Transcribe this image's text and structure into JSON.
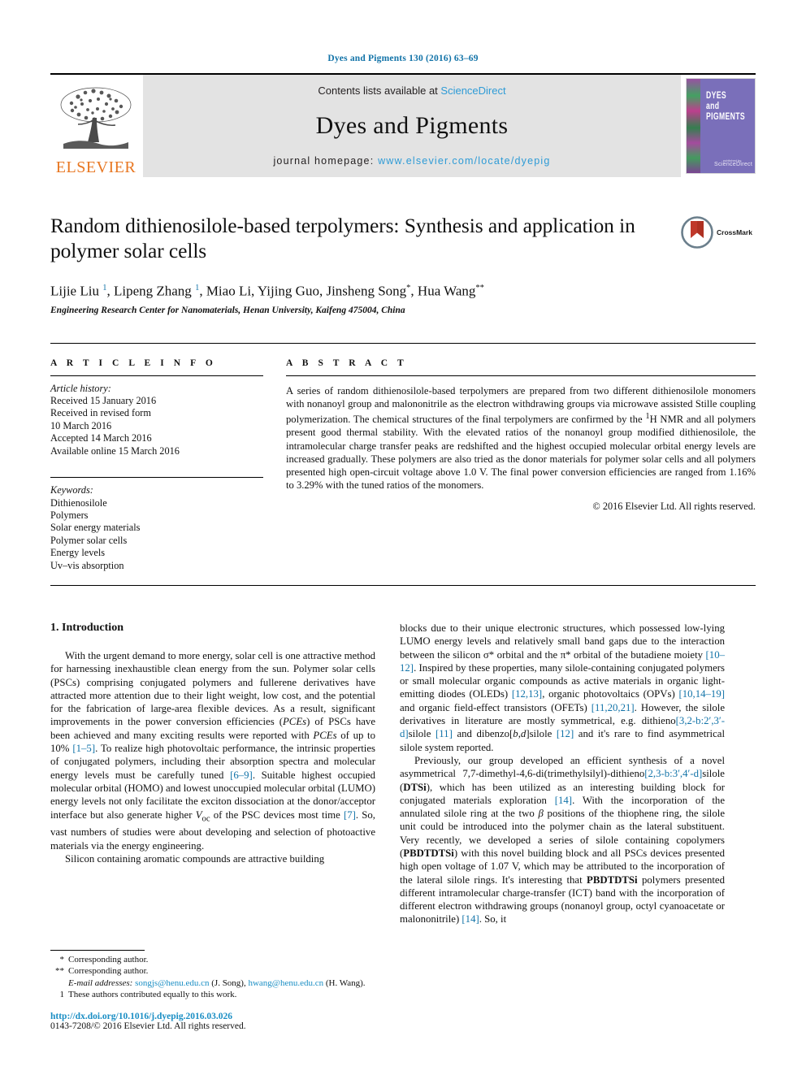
{
  "running_head": "Dyes and Pigments 130 (2016) 63–69",
  "masthead": {
    "publisher_wordmark": "ELSEVIER",
    "contents_prefix": "Contents lists available at ",
    "contents_link": "ScienceDirect",
    "journal_title": "Dyes and Pigments",
    "homepage_prefix": "journal homepage: ",
    "homepage_link": "www.elsevier.com/locate/dyepig",
    "cover_title_line1": "DYES",
    "cover_title_line2": "and",
    "cover_title_line3": "PIGMENTS",
    "cover_pub_note": "published by",
    "cover_pub_name": "ScienceDirect",
    "accent_link_color": "#2e9bd6",
    "elsevier_orange": "#e87722",
    "cover_purple": "#7a6fba"
  },
  "article": {
    "title": "Random dithienosilole-based terpolymers: Synthesis and application in polymer solar cells",
    "crossmark_label": "CrossMark",
    "authors_html": "Lijie Liu <sup>1</sup>, Lipeng Zhang <sup>1</sup>, Miao Li, Yijing Guo, Jinsheng Song<sup class=\"star\">*</sup>, Hua Wang<sup class=\"star\">**</sup>",
    "affiliation": "Engineering Research Center for Nanomaterials, Henan University, Kaifeng 475004, China"
  },
  "article_info": {
    "heading": "A R T I C L E   I N F O",
    "history_label": "Article history:",
    "history_lines": [
      "Received 15 January 2016",
      "Received in revised form",
      "10 March 2016",
      "Accepted 14 March 2016",
      "Available online 15 March 2016"
    ],
    "keywords_label": "Keywords:",
    "keywords": [
      "Dithienosilole",
      "Polymers",
      "Solar energy materials",
      "Polymer solar cells",
      "Energy levels",
      "Uv–vis absorption"
    ]
  },
  "abstract": {
    "heading": "A B S T R A C T",
    "text": "A series of random dithienosilole-based terpolymers are prepared from two different dithienosilole monomers with nonanoyl group and malononitrile as the electron withdrawing groups via microwave assisted Stille coupling polymerization. The chemical structures of the final terpolymers are confirmed by the 1H NMR and all polymers present good thermal stability. With the elevated ratios of the nonanoyl group modified dithienosilole, the intramolecular charge transfer peaks are redshifted and the highest occupied molecular orbital energy levels are increased gradually. These polymers are also tried as the donor materials for polymer solar cells and all polymers presented high open-circuit voltage above 1.0 V. The final power conversion efficiencies are ranged from 1.16% to 3.29% with the tuned ratios of the monomers.",
    "copyright": "© 2016 Elsevier Ltd. All rights reserved."
  },
  "body": {
    "section_title": "1. Introduction",
    "left_paragraphs": [
      "With the urgent demand to more energy, solar cell is one attractive method for harnessing inexhaustible clean energy from the sun. Polymer solar cells (PSCs) comprising conjugated polymers and fullerene derivatives have attracted more attention due to their light weight, low cost, and the potential for the fabrication of large-area flexible devices. As a result, significant improvements in the power conversion efficiencies (PCEs) of PSCs have been achieved and many exciting results were reported with PCEs of up to 10% [1–5]. To realize high photovoltaic performance, the intrinsic properties of conjugated polymers, including their absorption spectra and molecular energy levels must be carefully tuned [6–9]. Suitable highest occupied molecular orbital (HOMO) and lowest unoccupied molecular orbital (LUMO) energy levels not only facilitate the exciton dissociation at the donor/acceptor interface but also generate higher Voc of the PSC devices most time [7]. So, vast numbers of studies were about developing and selection of photoactive materials via the energy engineering.",
      "Silicon containing aromatic compounds are attractive building"
    ],
    "right_paragraphs": [
      "blocks due to their unique electronic structures, which possessed low-lying LUMO energy levels and relatively small band gaps due to the interaction between the silicon σ* orbital and the π* orbital of the butadiene moiety [10–12]. Inspired by these properties, many silole-containing conjugated polymers or small molecular organic compounds as active materials in organic light-emitting diodes (OLEDs) [12,13], organic photovoltaics (OPVs) [10,14–19] and organic field-effect transistors (OFETs) [11,20,21]. However, the silole derivatives in literature are mostly symmetrical, e.g. dithieno[3,2-b:2′,3′-d]silole [11] and dibenzo[b,d]silole [12] and it's rare to find asymmetrical silole system reported.",
      "Previously, our group developed an efficient synthesis of a novel asymmetrical 7,7-dimethyl-4,6-di(trimethylsilyl)-dithieno[2,3-b:3′,4′-d]silole (DTSi), which has been utilized as an interesting building block for conjugated materials exploration [14]. With the incorporation of the annulated silole ring at the two β positions of the thiophene ring, the silole unit could be introduced into the polymer chain as the lateral substituent. Very recently, we developed a series of silole containing copolymers (PBDTDTSi) with this novel building block and all PSCs devices presented high open voltage of 1.07 V, which may be attributed to the incorporation of the lateral silole rings. It's interesting that PBDTDTSi polymers presented different intramolecular charge-transfer (ICT) band with the incorporation of different electron withdrawing groups (nonanoyl group, octyl cyanoacetate or malononitrile) [14]. So, it"
    ],
    "reference_color": "#1273a8"
  },
  "footnotes": {
    "lines": [
      {
        "mark": "*",
        "text": "Corresponding author."
      },
      {
        "mark": "**",
        "text": "Corresponding author."
      }
    ],
    "email_label": "E-mail addresses:",
    "email1": "songjs@henu.edu.cn",
    "email1_name": "(J. Song),",
    "email2": "hwang@henu.edu.cn",
    "email2_name": "(H. Wang).",
    "equal_mark": "1",
    "equal_text": "These authors contributed equally to this work.",
    "doi": "http://dx.doi.org/10.1016/j.dyepig.2016.03.026",
    "issn": "0143-7208/© 2016 Elsevier Ltd. All rights reserved."
  }
}
